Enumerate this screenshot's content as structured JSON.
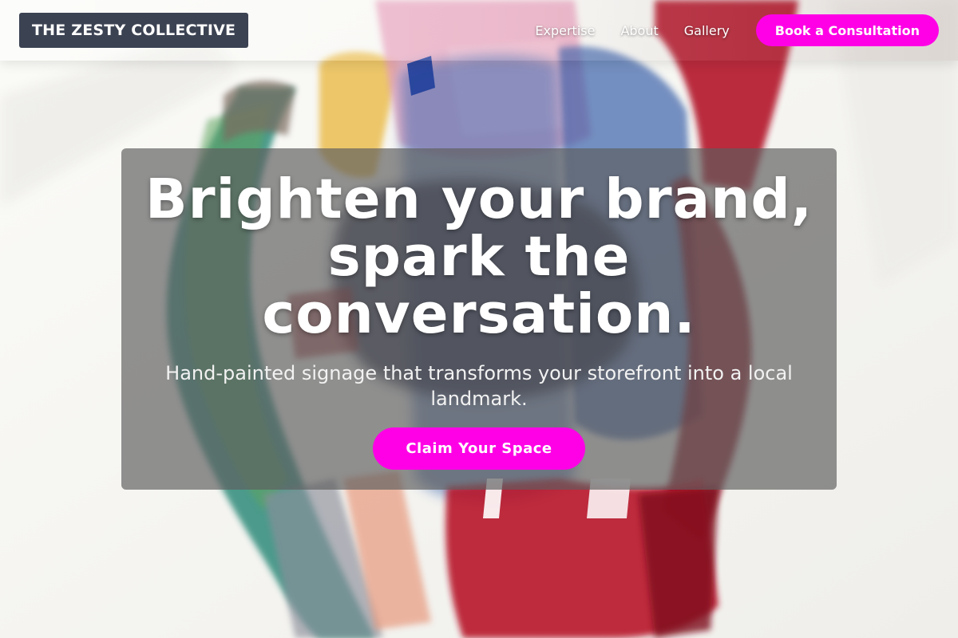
{
  "brand": {
    "name": "THE ZESTY COLLECTIVE"
  },
  "nav": {
    "items": [
      {
        "label": "Expertise"
      },
      {
        "label": "About"
      },
      {
        "label": "Gallery"
      }
    ],
    "cta_label": "Book a Consultation"
  },
  "hero": {
    "title_lines": [
      "Brighten your brand,",
      "spark the",
      "conversation."
    ],
    "subtitle": "Hand-painted signage that transforms your storefront into a local landmark.",
    "cta_label": "Claim Your Space",
    "background_image": "abstract-watercolor-brushstrokes"
  },
  "colors": {
    "accent": "#ff00e6",
    "logo_background": "#3b4252",
    "card_overlay": "#5f5f5f"
  }
}
